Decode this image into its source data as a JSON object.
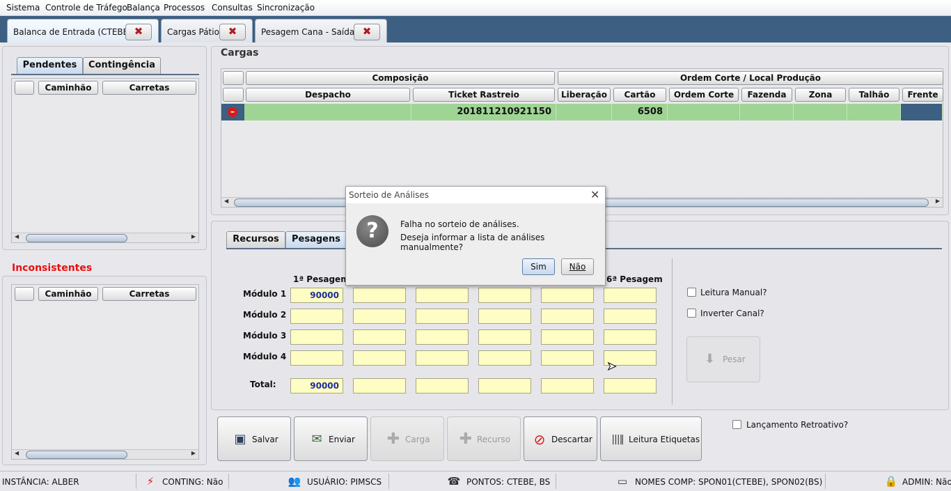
{
  "menu": [
    "Sistema",
    "Controle de Tráfego",
    "Balança",
    "Processos",
    "Consultas",
    "Sincronização"
  ],
  "doc_tabs": [
    {
      "label": "Balanca de Entrada (CTEBE)",
      "active": true
    },
    {
      "label": "Cargas Pátio",
      "active": false
    },
    {
      "label": "Pesagem Cana - Saída",
      "active": false
    }
  ],
  "left": {
    "tabs": [
      "Pendentes",
      "Contingência"
    ],
    "columns": [
      "Caminhão",
      "Carretas"
    ],
    "inconsistentes_title": "Inconsistentes",
    "inconsistentes_columns": [
      "Caminhão",
      "Carretas"
    ]
  },
  "cargas": {
    "title": "Cargas",
    "groups": [
      "Composição",
      "Ordem Corte / Local Produção"
    ],
    "columns": [
      "Despacho",
      "Ticket Rastreio",
      "Liberação",
      "Cartão",
      "Ordem Corte",
      "Fazenda",
      "Zona",
      "Talhão",
      "Frente"
    ],
    "rows": [
      {
        "despacho": "",
        "ticket": "201811210921150",
        "liberacao": "",
        "cartao": "6508",
        "ordem_corte": "",
        "fazenda": "",
        "zona": "",
        "talhao": "",
        "frente": ""
      }
    ]
  },
  "pesagens": {
    "tabs": [
      "Recursos",
      "Pesagens"
    ],
    "first_header": "1ª Pesagem",
    "last_header": "6ª Pesagem",
    "rows": [
      "Módulo 1",
      "Módulo 2",
      "Módulo 3",
      "Módulo 4"
    ],
    "total_label": "Total:",
    "modulo1_value": "90000",
    "total_value": "90000",
    "leitura_manual": "Leitura Manual?",
    "inverter_canal": "Inverter Canal?",
    "pesar": "Pesar"
  },
  "actions": {
    "salvar": "Salvar",
    "enviar": "Enviar",
    "carga": "Carga",
    "recurso": "Recurso",
    "descartar": "Descartar",
    "leitura_etiquetas": "Leitura Etiquetas",
    "lancamento_retroativo": "Lançamento Retroativo?"
  },
  "status": {
    "instancia": "INSTÂNCIA: ALBER",
    "conting": "CONTING: Não",
    "usuario": "USUÁRIO: PIMSCS",
    "pontos": "PONTOS: CTEBE, BS",
    "nomes_comp": "NOMES COMP: SPON01(CTEBE), SPON02(BS)",
    "admin": "ADMIN: Não"
  },
  "dialog": {
    "title": "Sorteio de Análises",
    "line1": "Falha no sorteio de análises.",
    "line2": "Deseja informar a lista de análises manualmente?",
    "yes": "Sim",
    "no": "Não"
  },
  "colors": {
    "tabbar": "#3c5f82",
    "row_green": "#9fd494",
    "selected_cell": "#3c5f82",
    "input_yellow": "#fdfdc4",
    "inconsistent_red": "#e81010"
  },
  "icons": [
    "close-icon",
    "remove-icon",
    "question-icon",
    "save-icon",
    "send-icon",
    "add-icon",
    "cancel-icon",
    "barcode-icon",
    "download-icon",
    "plug-icon",
    "users-icon",
    "phone-icon",
    "monitor-icon",
    "lock-icon",
    "cursor-icon"
  ]
}
